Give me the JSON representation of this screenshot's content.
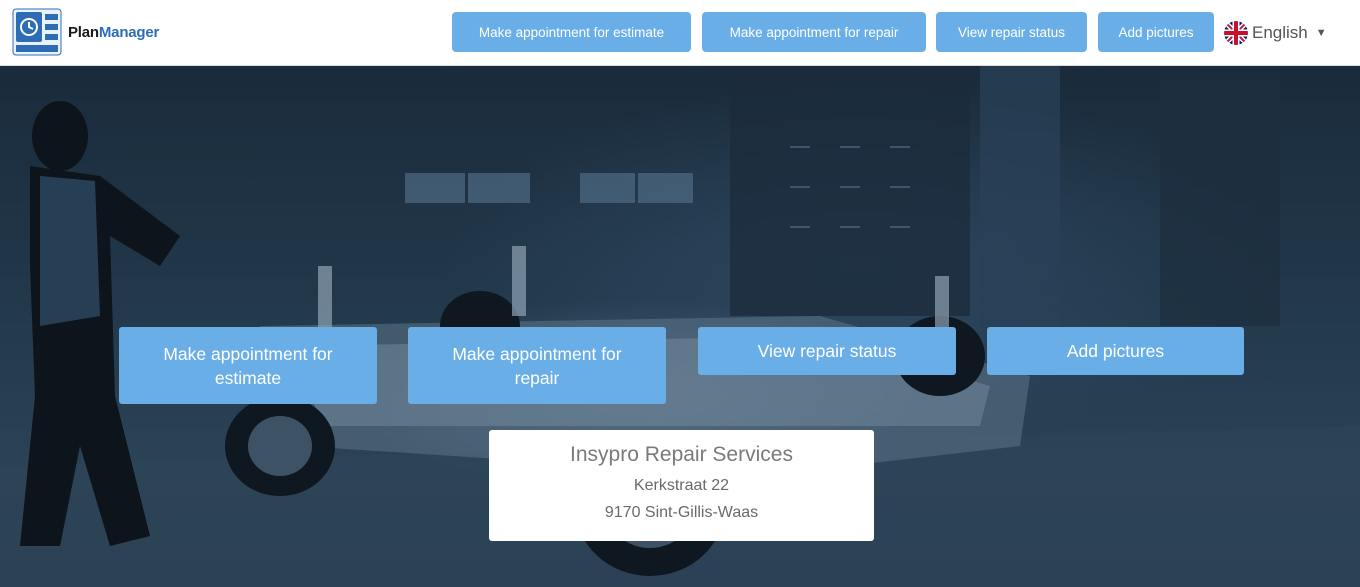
{
  "header": {
    "logo": {
      "brand_part1": "Plan",
      "brand_part2": "Manager",
      "icon": "planmanager-logo-icon"
    },
    "nav": [
      {
        "label": "Make appointment for estimate"
      },
      {
        "label": "Make appointment for repair"
      },
      {
        "label": "View repair status"
      },
      {
        "label": "Add pictures"
      }
    ],
    "language": {
      "label": "English",
      "flag_icon": "uk-flag-icon",
      "dropdown_icon": "caret-down-icon"
    }
  },
  "hero": {
    "buttons": [
      {
        "label": "Make appointment for estimate"
      },
      {
        "label": "Make appointment for repair"
      },
      {
        "label": "View repair status"
      },
      {
        "label": "Add pictures"
      }
    ],
    "address": {
      "company": "Insypro Repair Services",
      "street": "Kerkstraat 22",
      "city": "9170 Sint-Gillis-Waas"
    }
  },
  "colors": {
    "accent_button": "#6aaee8",
    "brand_blue": "#2d6db5",
    "hero_background": "#1f3244"
  }
}
